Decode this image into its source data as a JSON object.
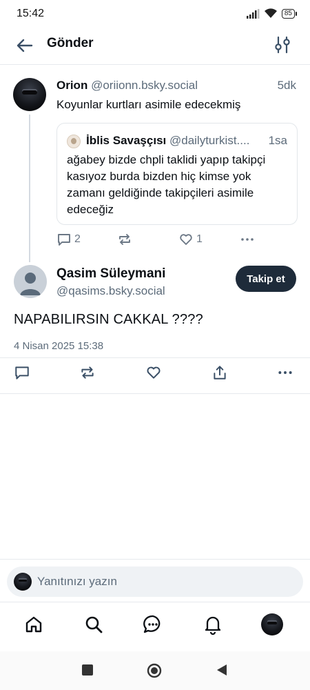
{
  "status_bar": {
    "time": "15:42",
    "battery": "85"
  },
  "header": {
    "title": "Gönder"
  },
  "post1": {
    "author_name": "Orion",
    "author_handle": "@oriionn.bsky.social",
    "time": "5dk",
    "text": "Koyunlar kurtları asimile edecekmiş",
    "quote": {
      "author_name": "İblis Savaşçısı",
      "author_handle": "@dailyturkist....",
      "time": "1sa",
      "text": "ağabey bizde chpli taklidi yapıp takipçi kasıyoz burda bizden hiç kimse yok zamanı geldiğinde takipçileri asimile edeceğiz"
    },
    "reply_count": "2",
    "like_count": "1"
  },
  "post2": {
    "author_name": "Qasim Süleymani",
    "author_handle": "@qasims.bsky.social",
    "follow_label": "Takip et",
    "text": "NAPABILIRSIN CAKKAL ????",
    "date": "4 Nisan 2025 15:38"
  },
  "reply_bar": {
    "placeholder": "Yanıtınızı yazın"
  },
  "bottom_nav": [
    "home-icon",
    "search-icon",
    "chat-icon",
    "bell-icon",
    "profile-avatar"
  ],
  "colors": {
    "accent_dark": "#1e2b3a",
    "muted_text": "#5c6b7a",
    "icon_gray": "#6b7785",
    "border": "#e6e9ed"
  }
}
